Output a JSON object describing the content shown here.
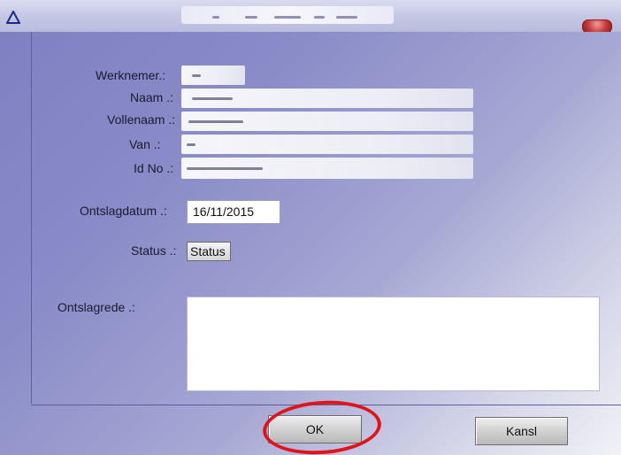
{
  "fields": {
    "werknemer_label": "Werknemer.:",
    "naam_label": "Naam .:",
    "vollenaam_label": "Vollenaam .:",
    "van_label": "Van .:",
    "idno_label": "Id No .:",
    "ontslagdatum_label": "Ontslagdatum .:",
    "ontslagdatum_value": "16/11/2015",
    "status_label": "Status .:",
    "status_button": "Status",
    "ontslagrede_label": "Ontslagrede .:"
  },
  "buttons": {
    "ok": "OK",
    "kansl": "Kansl"
  },
  "colors": {
    "annotation_circle": "#e0141b",
    "client_background_start": "#7e80c2"
  },
  "icons": {
    "app": "warning-triangle-icon",
    "close": "close-icon"
  }
}
